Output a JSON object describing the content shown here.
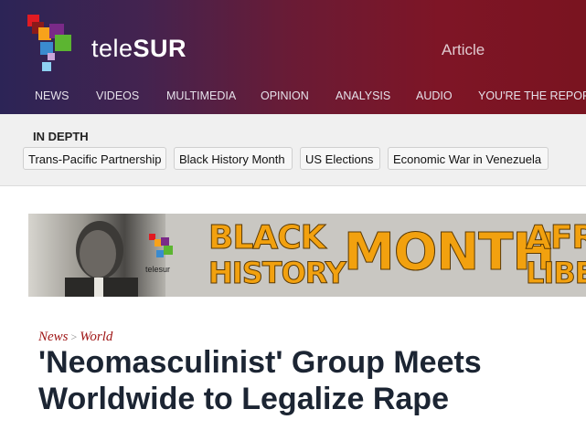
{
  "brand": {
    "name_part1": "tele",
    "name_part2": "SUR"
  },
  "section_label": "Article",
  "nav": [
    "NEWS",
    "VIDEOS",
    "MULTIMEDIA",
    "OPINION",
    "ANALYSIS",
    "AUDIO",
    "YOU'RE THE REPOR"
  ],
  "indepth": {
    "title": "IN DEPTH",
    "tags": [
      "Trans-Pacific Partnership",
      "Black History Month",
      "US Elections",
      "Economic War in Venezuela"
    ]
  },
  "banner": {
    "logo_text": "telesur",
    "line1a": "BLACK",
    "line1b": "MONTH",
    "line1c": "AFR",
    "line2a": "HISTORY",
    "line2c": "LIBE"
  },
  "breadcrumb": {
    "section": "News",
    "separator": ">",
    "subsection": "World"
  },
  "headline": "'Neomasculinist' Group Meets Worldwide to Legalize Rape",
  "colors": {
    "header_left": "#2c2456",
    "header_right": "#7a1420",
    "accent_red": "#a01818",
    "banner_orange": "#f2a10f"
  }
}
